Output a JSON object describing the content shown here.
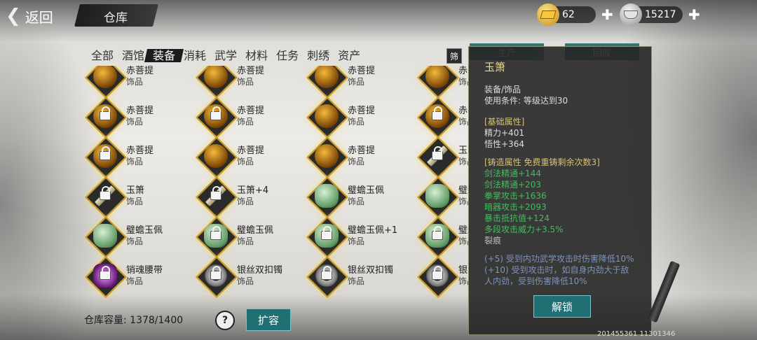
{
  "header": {
    "back_label": "返回",
    "title": "仓库"
  },
  "currency": {
    "gold": "62",
    "silver": "15217"
  },
  "tabs": [
    "全部",
    "酒馆",
    "装备",
    "消耗",
    "武学",
    "材料",
    "任务",
    "刺绣",
    "资产"
  ],
  "active_tab": "装备",
  "filter_label": "筛",
  "side_tabs": [
    "生产",
    "回收"
  ],
  "items": [
    {
      "name": "赤菩提",
      "type": "饰品",
      "icon": "amber"
    },
    {
      "name": "赤菩提",
      "type": "饰品",
      "icon": "amber"
    },
    {
      "name": "赤菩提",
      "type": "饰品",
      "icon": "amber"
    },
    {
      "name": "赤菩提",
      "type": "饰品",
      "icon": "amber"
    },
    {
      "name": "赤菩提",
      "type": "饰品",
      "icon": "amber",
      "locked": true
    },
    {
      "name": "赤菩提",
      "type": "饰品",
      "icon": "amber",
      "locked": true
    },
    {
      "name": "赤菩提",
      "type": "饰品",
      "icon": "amber"
    },
    {
      "name": "赤菩提",
      "type": "饰品",
      "icon": "amber",
      "locked": true
    },
    {
      "name": "赤菩提",
      "type": "饰品",
      "icon": "amber",
      "locked": true
    },
    {
      "name": "赤菩提",
      "type": "饰品",
      "icon": "amber"
    },
    {
      "name": "赤菩提",
      "type": "饰品",
      "icon": "amber"
    },
    {
      "name": "玉箫",
      "type": "饰品",
      "icon": "flute",
      "locked": true
    },
    {
      "name": "玉箫",
      "type": "饰品",
      "icon": "flute",
      "locked": true
    },
    {
      "name": "玉箫+4",
      "type": "饰品",
      "icon": "flute",
      "locked": true
    },
    {
      "name": "璧蟾玉佩",
      "type": "饰品",
      "icon": "jade"
    },
    {
      "name": "璧蟾玉佩",
      "type": "饰品",
      "icon": "jade"
    },
    {
      "name": "璧蟾玉佩",
      "type": "饰品",
      "icon": "jade"
    },
    {
      "name": "璧蟾玉佩",
      "type": "饰品",
      "icon": "jade",
      "locked": true
    },
    {
      "name": "璧蟾玉佩+1",
      "type": "饰品",
      "icon": "jade",
      "locked": true
    },
    {
      "name": "璧蟾玉佩",
      "type": "饰品",
      "icon": "jade",
      "locked": true
    },
    {
      "name": "销魂腰带",
      "type": "饰品",
      "icon": "belt",
      "locked": true
    },
    {
      "name": "银丝双扣镯",
      "type": "饰品",
      "icon": "bracelet",
      "locked": true
    },
    {
      "name": "银丝双扣镯",
      "type": "饰品",
      "icon": "bracelet",
      "locked": true
    },
    {
      "name": "银丝双扣镯",
      "type": "饰品",
      "icon": "bracelet",
      "locked": true
    }
  ],
  "footer": {
    "capacity_label": "仓库容量:",
    "capacity_value": "1378/1400",
    "help_label": "?",
    "expand_label": "扩容"
  },
  "detail": {
    "name": "玉箫",
    "category": "装备/饰品",
    "requirement": "使用条件:   等级达到30",
    "base_header": "[基础属性]",
    "base_attrs": [
      "精力+401",
      "悟性+364"
    ],
    "forge_header": "[铸造属性  免费重铸剩余次数3]",
    "forge_attrs": [
      "剑法精通+144",
      "剑法精通+203",
      "拳掌攻击+1636",
      "暗器攻击+2093",
      "暴击抵抗值+124",
      "多段攻击威力+3.5%"
    ],
    "status": "裂痕",
    "effects": [
      "(+5) 受到内功武学攻击时伤害降低10%",
      "(+10) 受到攻击时，如自身内劲大于敌",
      "人内劲，受到伤害降低10%"
    ],
    "unlock_label": "解锁"
  },
  "bottom_stat": "201455361  11301346"
}
